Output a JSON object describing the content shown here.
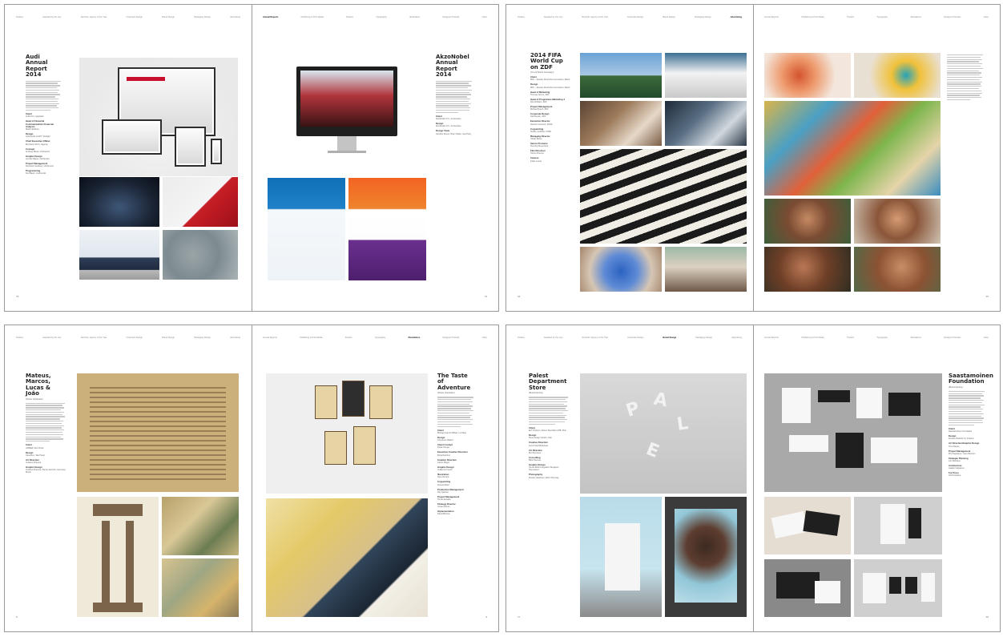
{
  "nav_left": [
    "Preface",
    "Awarded by the Jury",
    "Red Dot: Agency of the Year",
    "Corporate Design",
    "Brand Design",
    "Packaging Design",
    "Advertising"
  ],
  "nav_right": [
    "Annual Reports",
    "Publishing & Print Media",
    "Posters",
    "Typography",
    "Illustrations",
    "Designer Portraits",
    "Index"
  ],
  "spreads": {
    "s1": {
      "nav_active_right": "Annual Reports",
      "left": {
        "title": "Audi Annual Report 2014",
        "credits": [
          {
            "label": "Client",
            "value": "AUDI AG, Ingolstadt"
          },
          {
            "label": "Head of Financial Communication/ Financial Analysis",
            "value": "Martin Ebbinza"
          },
          {
            "label": "Design",
            "value": "strichpunkt GmbH, Stuttgart"
          },
          {
            "label": "Chief Executive Officer",
            "value": "Bernhard Ulrich, Jägersp."
          },
          {
            "label": "Concept",
            "value": "Andreas Bauer, strichpunkt"
          },
          {
            "label": "Graphic Design",
            "value": "Jennifer Bauer, strichpunkt"
          },
          {
            "label": "Project Management",
            "value": "Reinhard Greiderer, strichpunkt"
          },
          {
            "label": "Programming",
            "value": "Karl Baehr, strichpunkt"
          }
        ],
        "page_number": "78"
      },
      "right": {
        "title": "AkzoNobel Annual Report 2014",
        "credits": [
          {
            "label": "Client",
            "value": "AkzoNobel N.V., Amsterdam"
          },
          {
            "label": "Design",
            "value": "AkzoNobel N.V., Amsterdam"
          },
          {
            "label": "Design Team",
            "value": "Caroline Moore, Bram Hidde, Lisa Petty"
          }
        ],
        "page_number": "79"
      }
    },
    "s2": {
      "nav_active_left": "Advertising",
      "left": {
        "title": "2014 FIFA World Cup on ZDF",
        "subtitle": "(On-Air Brand Campaign)",
        "credits": [
          {
            "label": "Client",
            "value": "ZDF – Zweites Deutsches Fernsehen, Mainz"
          },
          {
            "label": "Design",
            "value": "ZDF – Zweites Deutsches Fernsehen, Mainz"
          },
          {
            "label": "Head of Marketing",
            "value": "Thomas Grimm, ZDF"
          },
          {
            "label": "Head of Programme Marketing 4",
            "value": "Dirk Wolfram, ZDF"
          },
          {
            "label": "Project Management",
            "value": "Michael Busch, ZDF"
          },
          {
            "label": "Corporate Design",
            "value": "Olaf Repsin, ZDF"
          },
          {
            "label": "Executive Director",
            "value": "Dietmar Gunzelot, KNSK"
          },
          {
            "label": "Copywriting",
            "value": "Steffen Goldhau, KNSK"
          },
          {
            "label": "Managing Director",
            "value": "Tobias Weiss"
          },
          {
            "label": "Senior Producer",
            "value": "Henning Meyerwerk"
          },
          {
            "label": "Film Direction",
            "value": "Torben Brenner"
          },
          {
            "label": "Camera",
            "value": "Fabio Loreto"
          }
        ],
        "page_number": "34"
      },
      "right": {
        "page_number": "35"
      }
    },
    "s3": {
      "nav_active_right": "Illustrations",
      "left": {
        "title": "Mateus, Marcos, Lucas & João",
        "subtitle": "(Poster Illustration)",
        "credits": [
          {
            "label": "Client",
            "value": "UNIMEP, Dez Poulo"
          },
          {
            "label": "Design",
            "value": "Casa Rex, São Paulo"
          },
          {
            "label": "Art Direction",
            "value": "Gustavo Piqueira"
          },
          {
            "label": "Graphic Design",
            "value": "Gustavo Piqueira, Samia Jacintho, Germana Monte"
          }
        ],
        "page_number": "8"
      },
      "right": {
        "title": "The Taste of Adventure",
        "subtitle": "(Poster Illustration)",
        "credits": [
          {
            "label": "Client",
            "value": "Bodega Garzón Bilbao, La Rioja"
          },
          {
            "label": "Design",
            "value": "Chemical, Madrid"
          },
          {
            "label": "Client Contact",
            "value": "Paula Ortega"
          },
          {
            "label": "Executive Creative Direction",
            "value": "Borja Ramírez"
          },
          {
            "label": "Creative Direction",
            "value": "Carlos Magro"
          },
          {
            "label": "Graphic Design",
            "value": "Guillermo Fuerte"
          },
          {
            "label": "Illustration",
            "value": "Sara Herrera"
          },
          {
            "label": "Copywriting",
            "value": "Susana Mato"
          },
          {
            "label": "Production Management",
            "value": "Dan Iglesias"
          },
          {
            "label": "Project Management",
            "value": "Tomás España"
          },
          {
            "label": "Strategy Director",
            "value": "Ismael Alonso"
          },
          {
            "label": "Implementation",
            "value": "David Barrera"
          }
        ],
        "page_number": "9"
      }
    },
    "s4": {
      "nav_active_left": "Brand Design",
      "left": {
        "title": "Palest Department Store",
        "subtitle": "(Brand Identity)",
        "credits": [
          {
            "label": "Client",
            "value": "ELT Kimbero, Palest Taxi/Jiddo UHB, Pink"
          },
          {
            "label": "Design",
            "value": "Neue Design Studio, Oslo"
          },
          {
            "label": "Creative Direction",
            "value": "Lars Kristof Bellefseer"
          },
          {
            "label": "Art Direction",
            "value": "Bror Rimeseu"
          },
          {
            "label": "Consulting",
            "value": "Bård Huesvel"
          },
          {
            "label": "Graphic Design",
            "value": "Henrik Bank Krogsland, Benjamin Svenssand"
          },
          {
            "label": "Photography",
            "value": "Kristian Jakobsen, Elins Thomsay"
          }
        ],
        "page_number": "27"
      },
      "right": {
        "title": "Saastamoinen Foundation",
        "subtitle": "(Brand Identity)",
        "credits": [
          {
            "label": "Client",
            "value": "Saastamoinen Foundation"
          },
          {
            "label": "Design",
            "value": "Kuudes Helsinki Oy, Finland"
          },
          {
            "label": "Art Direction/Graphic Design",
            "value": "Timo Rautio"
          },
          {
            "label": "Project Management",
            "value": "Pilvi Seppänen, Suvi Ahlström"
          },
          {
            "label": "Strategic Planning",
            "value": "Juri Ranttaus"
          },
          {
            "label": "Architecture",
            "value": "Jaakko Kaipainen"
          },
          {
            "label": "For Press",
            "value": "Orlo Kanttaus"
          }
        ],
        "page_number": "28"
      }
    }
  }
}
